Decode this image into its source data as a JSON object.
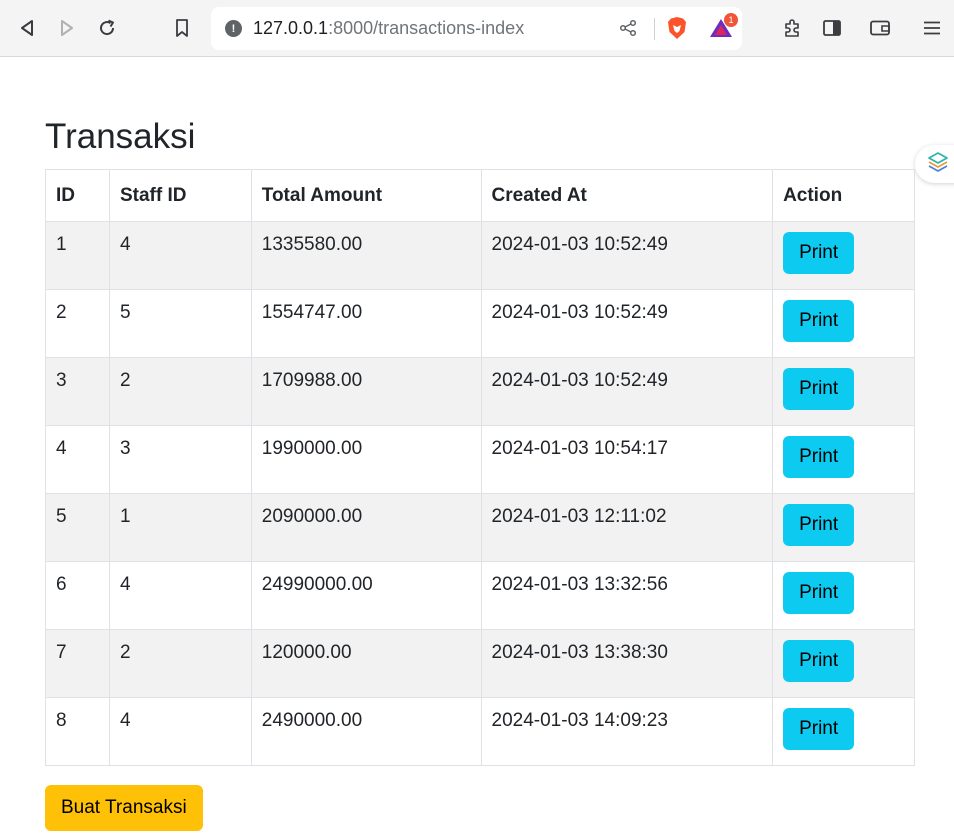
{
  "browser": {
    "url_host": "127.0.0.1",
    "url_rest": ":8000/transactions-index",
    "rewards_badge": "1"
  },
  "page": {
    "title": "Transaksi",
    "columns": [
      "ID",
      "Staff ID",
      "Total Amount",
      "Created At",
      "Action"
    ],
    "rows": [
      {
        "id": "1",
        "staff_id": "4",
        "total": "1335580.00",
        "created_at": "2024-01-03 10:52:49",
        "action": "Print"
      },
      {
        "id": "2",
        "staff_id": "5",
        "total": "1554747.00",
        "created_at": "2024-01-03 10:52:49",
        "action": "Print"
      },
      {
        "id": "3",
        "staff_id": "2",
        "total": "1709988.00",
        "created_at": "2024-01-03 10:52:49",
        "action": "Print"
      },
      {
        "id": "4",
        "staff_id": "3",
        "total": "1990000.00",
        "created_at": "2024-01-03 10:54:17",
        "action": "Print"
      },
      {
        "id": "5",
        "staff_id": "1",
        "total": "2090000.00",
        "created_at": "2024-01-03 12:11:02",
        "action": "Print"
      },
      {
        "id": "6",
        "staff_id": "4",
        "total": "24990000.00",
        "created_at": "2024-01-03 13:32:56",
        "action": "Print"
      },
      {
        "id": "7",
        "staff_id": "2",
        "total": "120000.00",
        "created_at": "2024-01-03 13:38:30",
        "action": "Print"
      },
      {
        "id": "8",
        "staff_id": "4",
        "total": "2490000.00",
        "created_at": "2024-01-03 14:09:23",
        "action": "Print"
      }
    ],
    "create_button": "Buat Transaksi"
  },
  "colors": {
    "print_button": "#0dcaf0",
    "create_button": "#ffc107",
    "striped_row": "#f2f2f2"
  }
}
